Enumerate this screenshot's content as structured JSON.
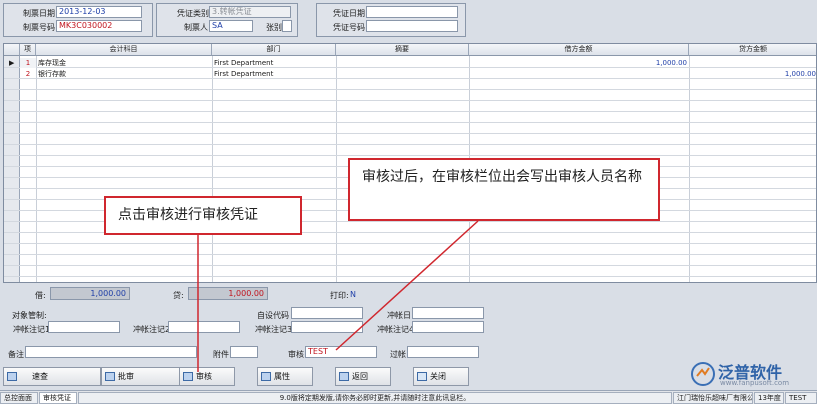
{
  "header": {
    "date_label": "制票日期",
    "date_value": "2013-12-03",
    "voucher_no_label": "制票号码",
    "voucher_no_value": "MK3C030002",
    "voucher_type_label": "凭证类别",
    "voucher_type_value": "3.转帐凭证",
    "maker_label": "制票人",
    "maker_value": "SA",
    "attach_label": "张别",
    "attach_value": "",
    "vdate_label": "凭证日期",
    "vdate_value": "",
    "vno_label": "凭证号码",
    "vno_value": ""
  },
  "grid": {
    "columns": [
      "项",
      "会计科目",
      "部门",
      "摘要",
      "借方金额",
      "贷方金额"
    ],
    "rows": [
      {
        "no": "1",
        "account": "库存现金",
        "dept": "First Department",
        "summary": "",
        "debit": "1,000.00",
        "credit": ""
      },
      {
        "no": "2",
        "account": "银行存款",
        "dept": "First Department",
        "summary": "",
        "debit": "",
        "credit": "1,000.00"
      }
    ]
  },
  "totals": {
    "debit_label": "借:",
    "debit_value": "1,000.00",
    "credit_label": "贷:",
    "credit_value": "1,000.00",
    "print_label": "打印:",
    "print_value": "N"
  },
  "extra": {
    "object_label": "对象管制:",
    "custom_label": "自设代码",
    "rev_date_label": "冲帐日",
    "note1_label": "冲帐注记1",
    "note2_label": "冲帐注记2",
    "note3_label": "冲帐注记3",
    "note4_label": "冲帐注记4",
    "remark_label": "备注",
    "attach_label": "附件",
    "audit_label": "审核",
    "audit_value": "TEST",
    "posting_label": "过帐"
  },
  "buttons": {
    "browse": "速查",
    "approve": "批审",
    "audit": "审核",
    "props": "属性",
    "back": "返回",
    "close": "关闭"
  },
  "status": {
    "tab1": "总控面面",
    "tab2": "审核凭证",
    "message": "9.0版将定期发版,请你务必即时更新,并请随时注意此讯息栏。",
    "company": "江门瑞怡乐超味厂有限公司",
    "period": "13年度",
    "user": "TEST"
  },
  "annotations": {
    "left_note": "点击审核进行审核凭证",
    "right_note": "审核过后，在审核栏位出会写出审核人员名称"
  },
  "watermark": {
    "brand": "泛普软件",
    "url": "www.fanpusoft.com"
  },
  "colors": {
    "annotation_border": "#d0272e",
    "amount_blue": "#1f3fa8",
    "value_red": "#c0141e"
  }
}
